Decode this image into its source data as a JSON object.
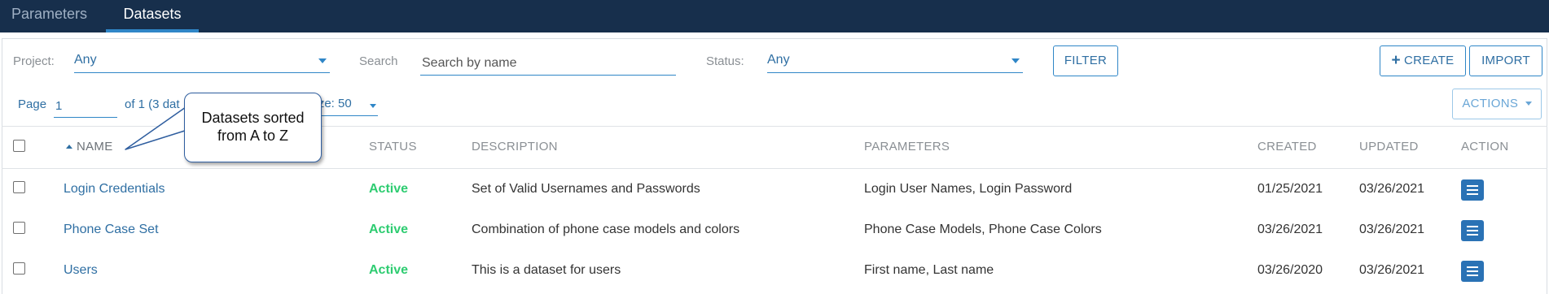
{
  "tabs": [
    {
      "label": "Parameters"
    },
    {
      "label": "Datasets"
    }
  ],
  "filters": {
    "project_label": "Project:",
    "project_value": "Any",
    "search_label": "Search",
    "search_placeholder": "Search by name",
    "status_label": "Status:",
    "status_value": "Any",
    "filter_button": "FILTER",
    "create_button": "CREATE",
    "import_button": "IMPORT"
  },
  "pagination": {
    "page_label": "Page",
    "page_value": "1",
    "of_text": "of 1 (3 dat",
    "size_text": "size: 50",
    "actions_button": "ACTIONS"
  },
  "callout": {
    "line1": "Datasets sorted",
    "line2": "from A to Z"
  },
  "columns": {
    "name": "NAME",
    "status": "STATUS",
    "description": "DESCRIPTION",
    "parameters": "PARAMETERS",
    "created": "CREATED",
    "updated": "UPDATED",
    "action": "ACTION"
  },
  "rows": [
    {
      "name": "Login Credentials",
      "status": "Active",
      "description": "Set of Valid Usernames and Passwords",
      "parameters": "Login User Names, Login Password",
      "created": "01/25/2021",
      "updated": "03/26/2021"
    },
    {
      "name": "Phone Case Set",
      "status": "Active",
      "description": "Combination of phone case models and colors",
      "parameters": "Phone Case Models, Phone Case Colors",
      "created": "03/26/2021",
      "updated": "03/26/2021"
    },
    {
      "name": "Users",
      "status": "Active",
      "description": "This is a dataset for users",
      "parameters": "First name, Last name",
      "created": "03/26/2020",
      "updated": "03/26/2021"
    }
  ],
  "colors": {
    "topbar": "#172f4c",
    "accent": "#2f86c7",
    "link": "#2f6fa3",
    "active_status": "#2ecc71",
    "action_button": "#2a72b5"
  },
  "icons": {
    "create": "plus-icon",
    "row_action": "menu-lines-icon",
    "sort": "sort-ascending-icon",
    "dropdown": "chevron-down-icon"
  }
}
